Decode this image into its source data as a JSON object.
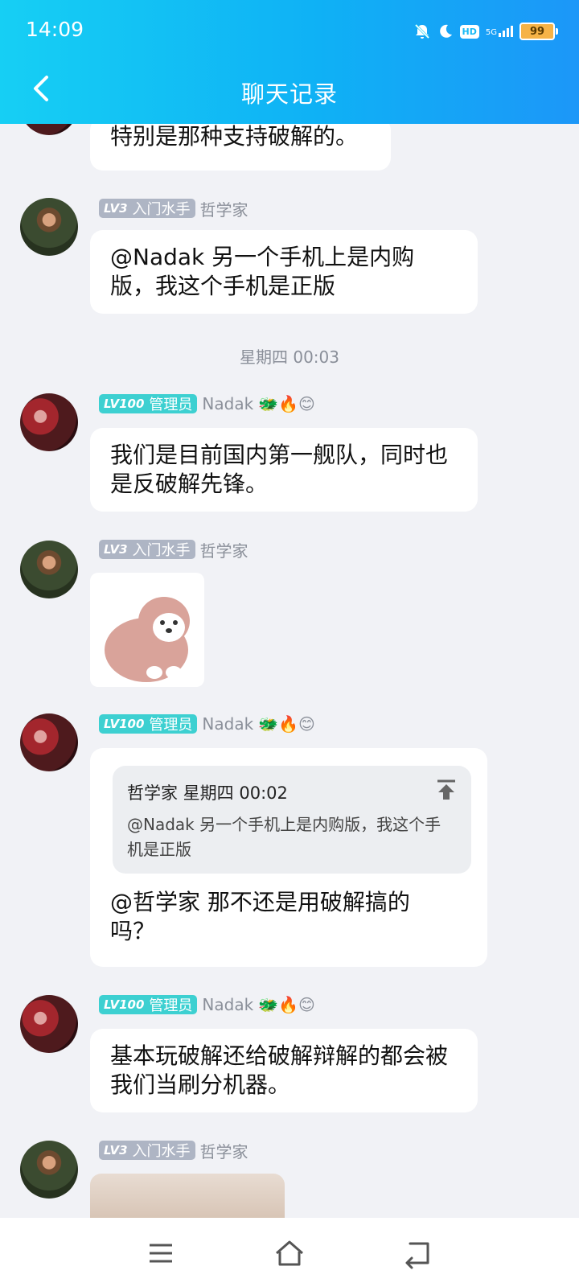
{
  "status_bar": {
    "time": "14:09",
    "icons": [
      "mute-bell-icon",
      "moon-icon",
      "hd-icon",
      "signal-5g-icon",
      "battery-icon"
    ],
    "hd_label": "HD",
    "network_label": "5G",
    "battery": "99"
  },
  "header": {
    "title": "聊天记录",
    "back_icon": "chevron-left-icon"
  },
  "messages": [
    {
      "text": "特别是那种支持破解的。"
    },
    {
      "badge": {
        "level": "LV3",
        "role": "入门水手"
      },
      "name": "哲学家",
      "text": "@Nadak 另一个手机上是内购版，我这个手机是正版"
    },
    {
      "timestamp": "星期四 00:03"
    },
    {
      "badge": {
        "level": "LV100",
        "role": "管理员"
      },
      "name": "Nadak",
      "emojis": "🐲🔥😊",
      "text": "我们是目前国内第一舰队，同时也是反破解先锋。"
    },
    {
      "badge": {
        "level": "LV3",
        "role": "入门水手"
      },
      "name": "哲学家",
      "sticker": "dog-sticker"
    },
    {
      "badge": {
        "level": "LV100",
        "role": "管理员"
      },
      "name": "Nadak",
      "emojis": "🐲🔥😊",
      "quote": {
        "header": "哲学家 星期四 00:02",
        "text": "@Nadak 另一个手机上是内购版，我这个手机是正版"
      },
      "text": "@哲学家 那不还是用破解搞的吗？"
    },
    {
      "badge": {
        "level": "LV100",
        "role": "管理员"
      },
      "name": "Nadak",
      "emojis": "🐲🔥😊",
      "text": "基本玩破解还给破解辩解的都会被我们当刷分机器。"
    },
    {
      "badge": {
        "level": "LV3",
        "role": "入门水手"
      },
      "name": "哲学家",
      "image": "partial-image"
    }
  ],
  "bottom_nav": {
    "icons": [
      "menu-icon",
      "home-icon",
      "back-icon"
    ]
  }
}
